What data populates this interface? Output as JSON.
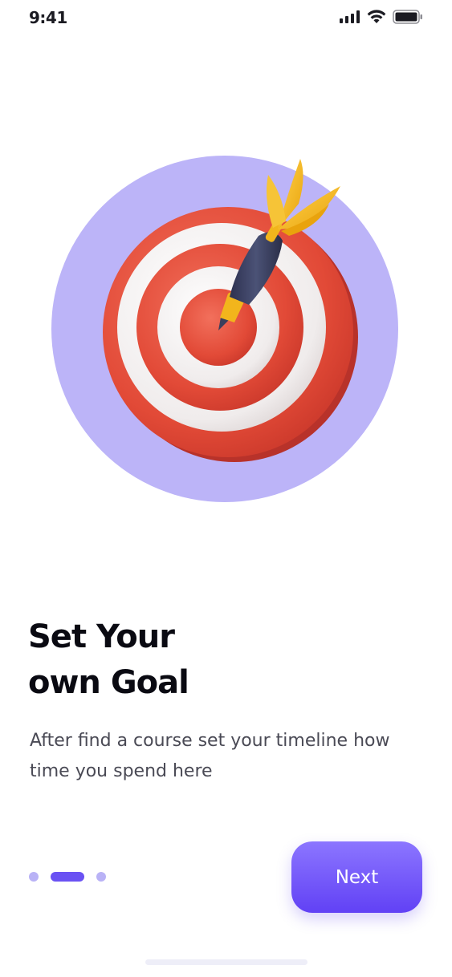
{
  "status_bar": {
    "time": "9:41",
    "icons": [
      "signal-icon",
      "wifi-icon",
      "battery-icon"
    ]
  },
  "illustration": {
    "name": "target-dart-illustration",
    "colors": {
      "backdrop": "#bcb4f8",
      "red": "#e8513f",
      "white": "#f1eeee",
      "dart_body": "#3a3f5c",
      "dart_flight": "#f4bb1f"
    }
  },
  "onboarding": {
    "title_line1": "Set Your",
    "title_line2": "own Goal",
    "description": "After find a course set your timeline how time you spend here",
    "pager": {
      "count": 3,
      "active_index": 1
    },
    "next_label": "Next"
  },
  "theme": {
    "accent": "#6a52f3",
    "accent_light": "#b9b2f6"
  }
}
